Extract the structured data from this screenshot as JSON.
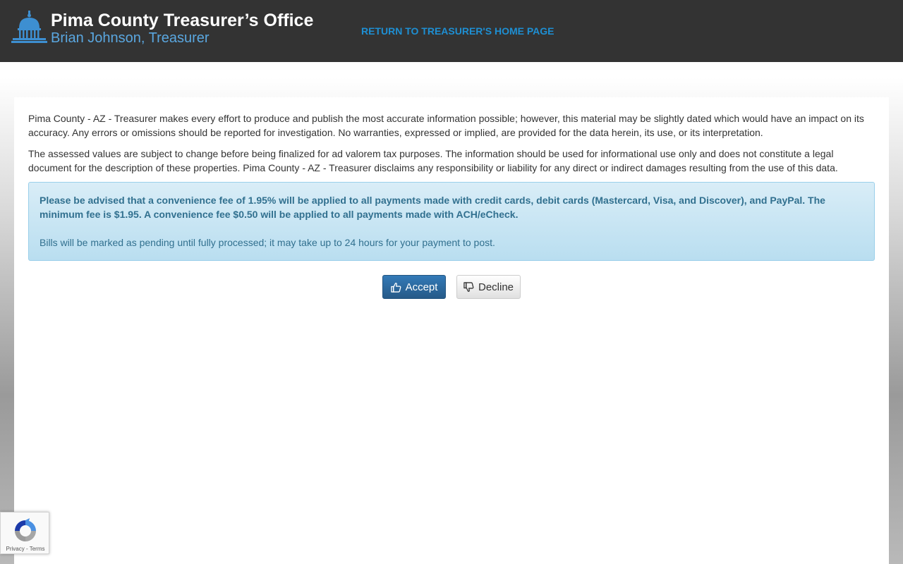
{
  "header": {
    "title": "Pima County Treasurer’s Office",
    "subtitle": "Brian Johnson, Treasurer",
    "home_link": "RETURN TO TREASURER'S HOME PAGE"
  },
  "disclaimer": {
    "paragraph1": "Pima County - AZ - Treasurer makes every effort to produce and publish the most accurate information possible; however, this material may be slightly dated which would have an impact on its accuracy. Any errors or omissions should be reported for investigation. No warranties, expressed or implied, are provided for the data herein, its use, or its interpretation.",
    "paragraph2": "The assessed values are subject to change before being finalized for ad valorem tax purposes. The information should be used for informational use only and does not constitute a legal document for the description of these properties. Pima County - AZ - Treasurer disclaims any responsibility or liability for any direct or indirect damages resulting from the use of this data."
  },
  "notice": {
    "fee_text": "Please be advised that a convenience fee of 1.95% will be applied to all payments made with credit cards, debit cards (Mastercard, Visa, and Discover), and PayPal. The minimum fee is $1.95. A convenience fee $0.50 will be applied to all payments made with ACH/eCheck.",
    "pending_text": "Bills will be marked as pending until fully processed; it may take up to 24 hours for your payment to post."
  },
  "actions": {
    "accept_label": "Accept",
    "decline_label": "Decline"
  },
  "recaptcha": {
    "privacy": "Privacy",
    "separator": " - ",
    "terms": "Terms"
  },
  "colors": {
    "header_bg": "#333333",
    "link": "#1e8fd3",
    "subtitle": "#5aa7e0",
    "alert_text": "#31708f",
    "accept_bg": "#337ab7"
  },
  "icons": {
    "logo": "capitol-dome-icon",
    "accept": "thumbs-up-icon",
    "decline": "thumbs-down-icon",
    "recaptcha": "recaptcha-icon"
  }
}
